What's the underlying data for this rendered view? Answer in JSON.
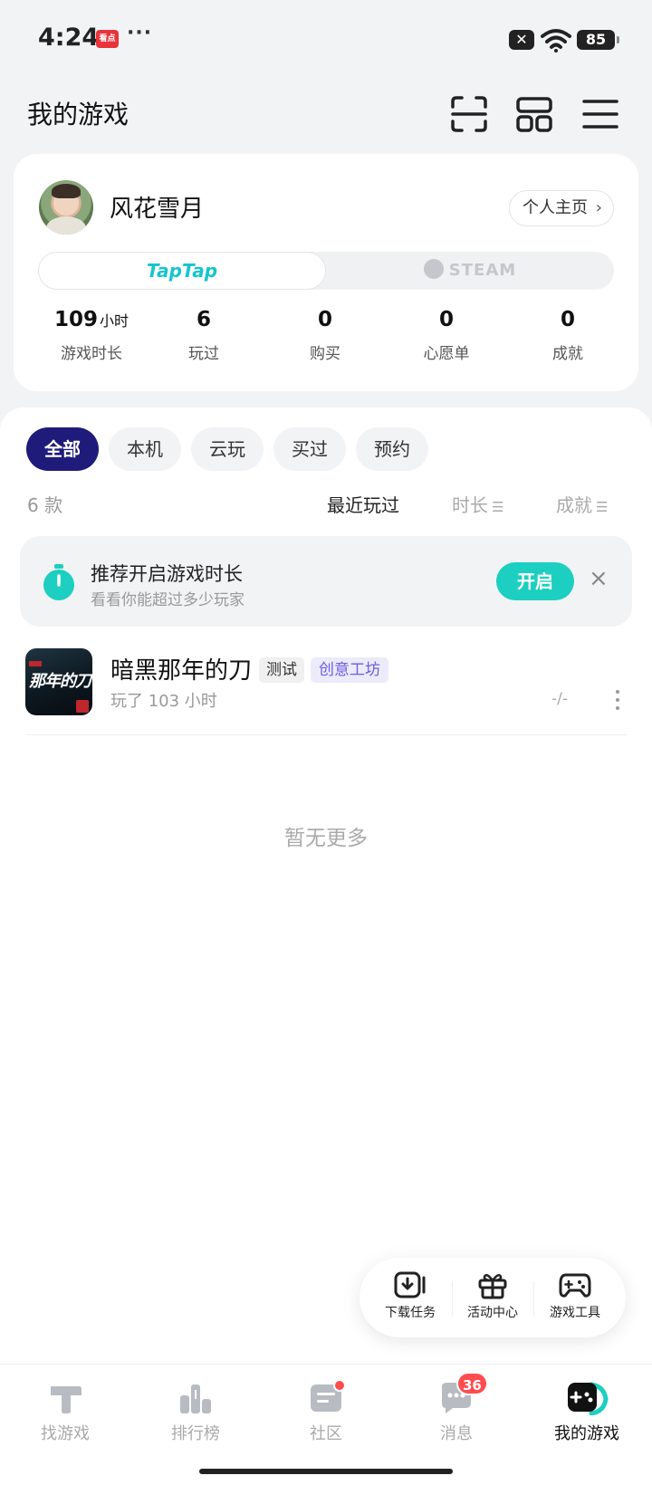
{
  "status_bar": {
    "time": "4:24",
    "news_badge": "看点",
    "dots": "···",
    "sim": "✕",
    "battery": "85"
  },
  "header": {
    "title": "我的游戏",
    "icons": [
      "scan-icon",
      "layout-icon",
      "menu-icon"
    ]
  },
  "profile": {
    "username": "风花雪月",
    "home_button": "个人主页",
    "platforms": [
      "TapTap",
      "STEAM"
    ],
    "stats": [
      {
        "value": "109",
        "unit": "小时",
        "label": "游戏时长"
      },
      {
        "value": "6",
        "label": "玩过"
      },
      {
        "value": "0",
        "label": "购买"
      },
      {
        "value": "0",
        "label": "心愿单"
      },
      {
        "value": "0",
        "label": "成就"
      }
    ]
  },
  "filters": [
    "全部",
    "本机",
    "云玩",
    "买过",
    "预约"
  ],
  "list": {
    "count": "6 款",
    "sorts": [
      "最近玩过",
      "时长",
      "成就"
    ]
  },
  "promo": {
    "title": "推荐开启游戏时长",
    "subtitle": "看看你能超过多少玩家",
    "button": "开启",
    "close": "×"
  },
  "games": [
    {
      "name": "暗黑那年的刀",
      "cover_text": "那年的刀",
      "tags": [
        "测试",
        "创意工坊"
      ],
      "play_time": "玩了 103 小时",
      "rating": "-/-"
    }
  ],
  "empty_text": "暂无更多",
  "float_bar": [
    "下载任务",
    "活动中心",
    "游戏工具"
  ],
  "bottom_nav": {
    "items": [
      "找游戏",
      "排行榜",
      "社区",
      "消息",
      "我的游戏"
    ],
    "message_badge": "36"
  },
  "colors": {
    "accent": "#1ccfc0",
    "active_filter": "#1f1b7a",
    "taptap": "#15c5ce",
    "badge": "#ff4d4f"
  }
}
